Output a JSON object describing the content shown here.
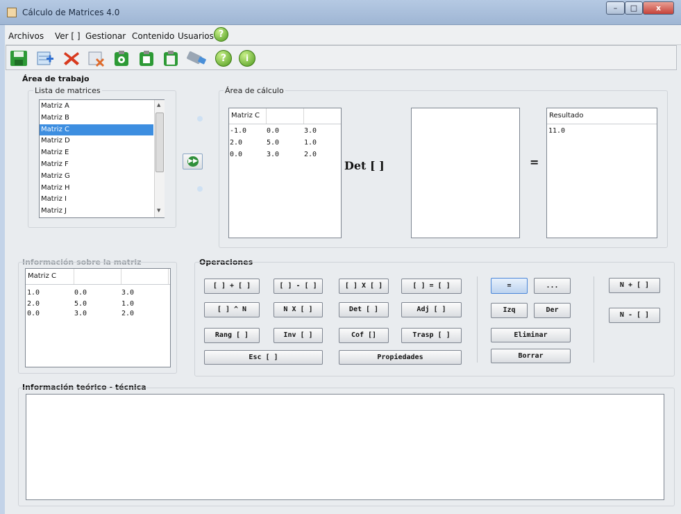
{
  "window": {
    "title": "Cálculo de Matrices 4.0",
    "min": "–",
    "max": "□",
    "close": "x"
  },
  "menu": [
    "Archivos",
    "Ver [ ]",
    "Gestionar",
    "Contenido",
    "Usuarios"
  ],
  "icons": {
    "app": "calculator-icon",
    "help_menu": "help-icon",
    "toolbar": [
      "save-icon",
      "new-matrix-icon",
      "delete-icon",
      "remove-matrix-icon",
      "clipboard-gear-icon",
      "clipboard-paste-icon",
      "clipboard-icon",
      "export-icon",
      "help-icon",
      "about-icon"
    ]
  },
  "work_area": {
    "title": "Área de trabajo",
    "list_label": "Lista de matrices",
    "matrices": [
      "Matriz A",
      "Matriz B",
      "Matriz C",
      "Matriz D",
      "Matriz E",
      "Matriz F",
      "Matriz G",
      "Matriz H",
      "Matriz I",
      "Matriz J"
    ],
    "selected_index": 2,
    "calc_label": "Área de cálculo",
    "operand_header": "Matriz C",
    "operand_rows": [
      [
        "-1.0",
        "0.0",
        "3.0"
      ],
      [
        "2.0",
        "5.0",
        "1.0"
      ],
      [
        "0.0",
        "3.0",
        "2.0"
      ]
    ],
    "operation": "Det [ ]",
    "equals": "=",
    "result_header": "Resultado",
    "result_value": "11.0"
  },
  "info": {
    "title": "Información sobre la matriz",
    "header": "Matriz C",
    "rows": [
      [
        "1.0",
        "0.0",
        "3.0"
      ],
      [
        "2.0",
        "5.0",
        "1.0"
      ],
      [
        "0.0",
        "3.0",
        "2.0"
      ]
    ]
  },
  "operations": {
    "title": "Operaciones",
    "buttons": {
      "add": "[ ] + [ ]",
      "sub": "[ ] - [ ]",
      "mul": "[ ] X [ ]",
      "assign": "[ ] = [ ]",
      "pow": "[ ] ^ N",
      "scalar": "N X [ ]",
      "det": "Det [ ]",
      "adj": "Adj [ ]",
      "rank": "Rang [ ]",
      "inv": "Inv [ ]",
      "cof": "Cof []",
      "trasp": "Trasp [ ]",
      "esc": "Esc [ ]",
      "props": "Propiedades",
      "equals": "=",
      "more": "...",
      "izq": "Izq",
      "der": "Der",
      "eliminar": "Eliminar",
      "borrar": "Borrar",
      "n_plus": "N + [ ]",
      "n_minus": "N - [ ]"
    }
  },
  "theory": {
    "title": "Información teórico - técnica",
    "text": ""
  },
  "colors": {
    "selection": "#3d8ee0",
    "help_green": "#4f9a1f",
    "delete_red": "#d83a1f",
    "save_green": "#2d9a36"
  }
}
